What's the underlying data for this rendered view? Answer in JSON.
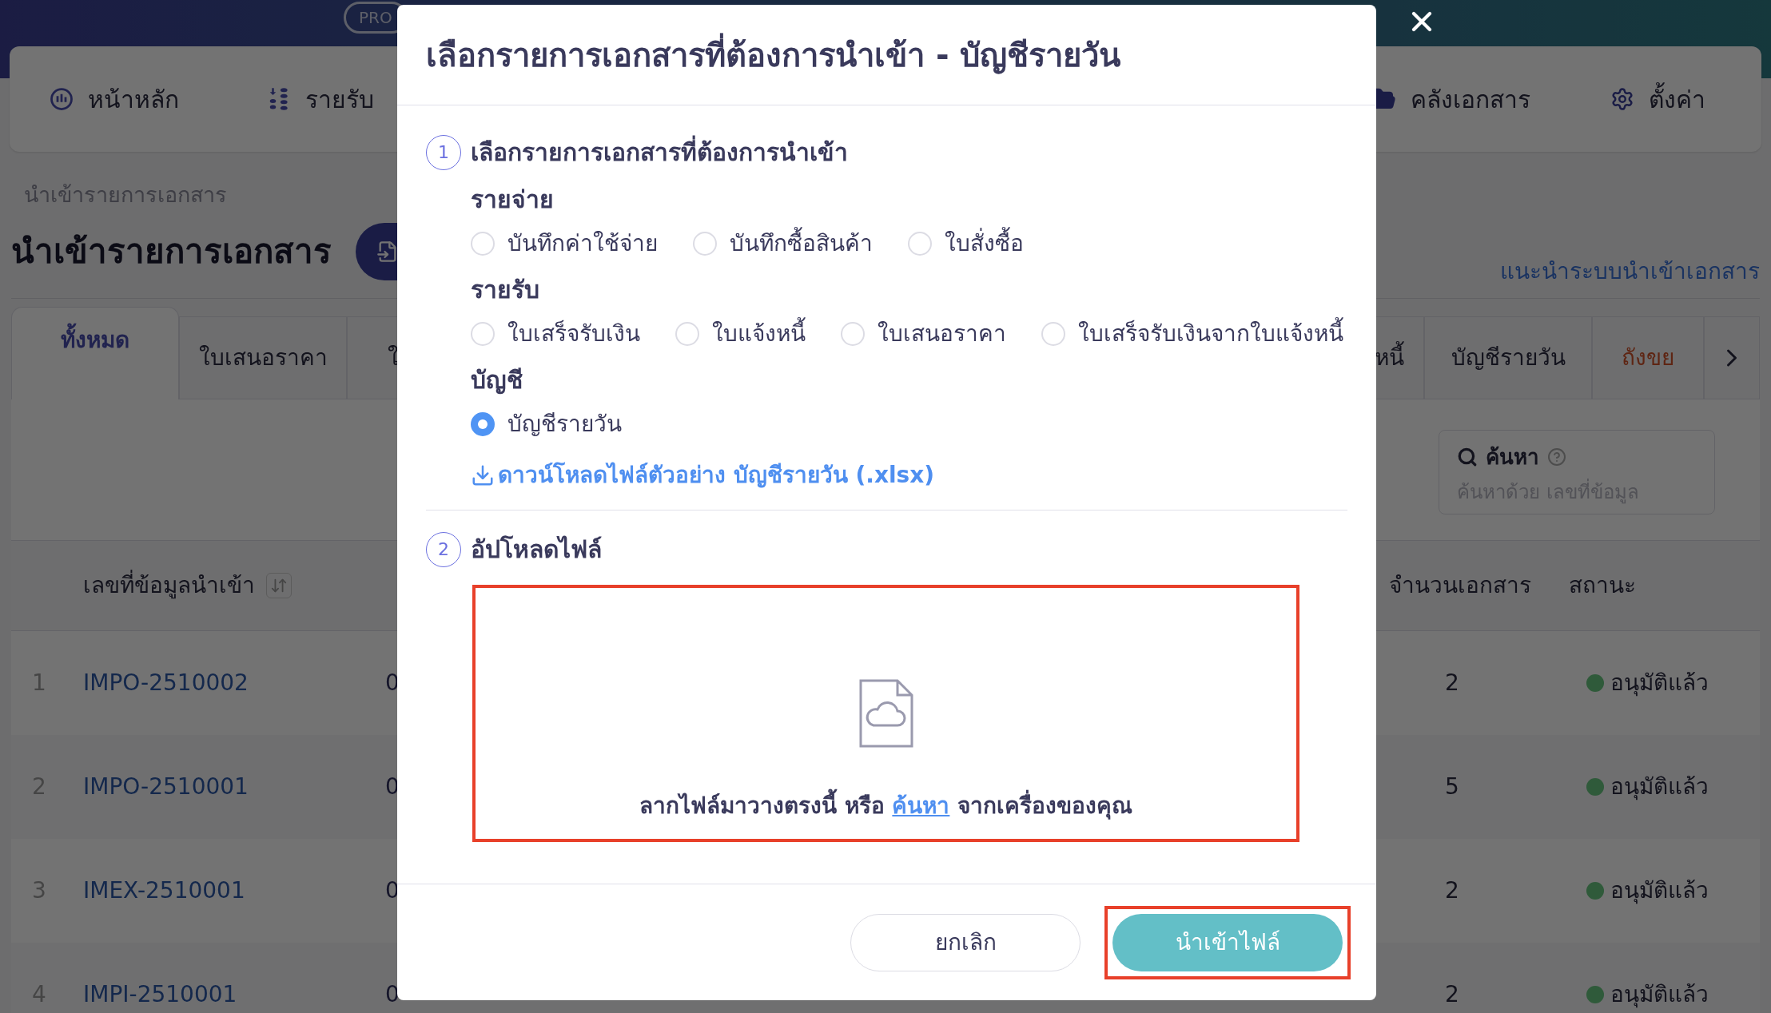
{
  "header": {
    "badges": [
      "PRO"
    ]
  },
  "nav": {
    "left": [
      "หน้าหลัก",
      "รายรับ"
    ],
    "right": [
      "คลังเอกสาร",
      "ตั้งค่า"
    ]
  },
  "breadcrumb": "นำเข้ารายการเอกสาร",
  "page_title": "นำเข้ารายการเอกสาร",
  "guide_link": "แนะนำระบบนำเข้าเอกสาร",
  "tabs_left": [
    {
      "label": "ทั้งหมด",
      "selected": true
    },
    {
      "label": "ใบเสนอราคา",
      "selected": false
    },
    {
      "label": "ใ",
      "selected": false
    }
  ],
  "tabs_right": [
    {
      "label": "หนี้",
      "selected": false
    },
    {
      "label": "บัญชีรายวัน",
      "selected": false
    },
    {
      "label": "ถังขย",
      "selected": false,
      "kind": "trash"
    }
  ],
  "search": {
    "label": "ค้นหา",
    "placeholder": "ค้นหาด้วย เลขที่ข้อมูล"
  },
  "table": {
    "columns": [
      "เลขที่ข้อมูลนำเข้า",
      "จำนวนเอกสาร",
      "สถานะ"
    ],
    "rows": [
      {
        "index": "1",
        "id": "IMPO-2510002",
        "column_3": "0",
        "count": "2",
        "status": "อนุมัติแล้ว",
        "color": "#2f5a3a"
      },
      {
        "index": "2",
        "id": "IMPO-2510001",
        "column_3": "0",
        "count": "5",
        "status": "อนุมัติแล้ว",
        "color": "#2f5a3a"
      },
      {
        "index": "3",
        "id": "IMEX-2510001",
        "column_3": "0",
        "count": "2",
        "status": "อนุมัติแล้ว",
        "color": "#2f5a3a"
      },
      {
        "index": "4",
        "id": "IMPI-2510001",
        "column_3": "0",
        "count": "2",
        "status": "อนุมัติแล้ว",
        "color": "#2f5a3a"
      }
    ]
  },
  "dialog": {
    "title": "เลือกรายการเอกสารที่ต้องการนำเข้า - บัญชีรายวัน",
    "step1": {
      "number": "1",
      "title": "เลือกรายการเอกสารที่ต้องการนำเข้า",
      "groups": [
        {
          "label": "รายจ่าย",
          "options": [
            {
              "label": "บันทึกค่าใช้จ่าย",
              "selected": false
            },
            {
              "label": "บันทึกซื้อสินค้า",
              "selected": false
            },
            {
              "label": "ใบสั่งซื้อ",
              "selected": false
            }
          ]
        },
        {
          "label": "รายรับ",
          "options": [
            {
              "label": "ใบเสร็จรับเงิน",
              "selected": false
            },
            {
              "label": "ใบแจ้งหนี้",
              "selected": false
            },
            {
              "label": "ใบเสนอราคา",
              "selected": false
            },
            {
              "label": "ใบเสร็จรับเงินจากใบแจ้งหนี้",
              "selected": false
            }
          ]
        },
        {
          "label": "บัญชี",
          "options": [
            {
              "label": "บัญชีรายวัน",
              "selected": true
            }
          ]
        }
      ],
      "download_link": "ดาวน์โหลดไฟล์ตัวอย่าง บัญชีรายวัน (.xlsx)"
    },
    "step2": {
      "number": "2",
      "title": "อัปโหลดไฟล์",
      "dropzone": {
        "highlighted": true,
        "text_before": "ลากไฟล์มาวางตรงนี้ หรือ",
        "link": "ค้นหา",
        "text_after": "จากเครื่องของคุณ"
      }
    },
    "cancel_button": {
      "label": "ยกเลิก"
    },
    "import_button": {
      "label": "นำเข้าไฟล์",
      "highlighted": true
    }
  }
}
